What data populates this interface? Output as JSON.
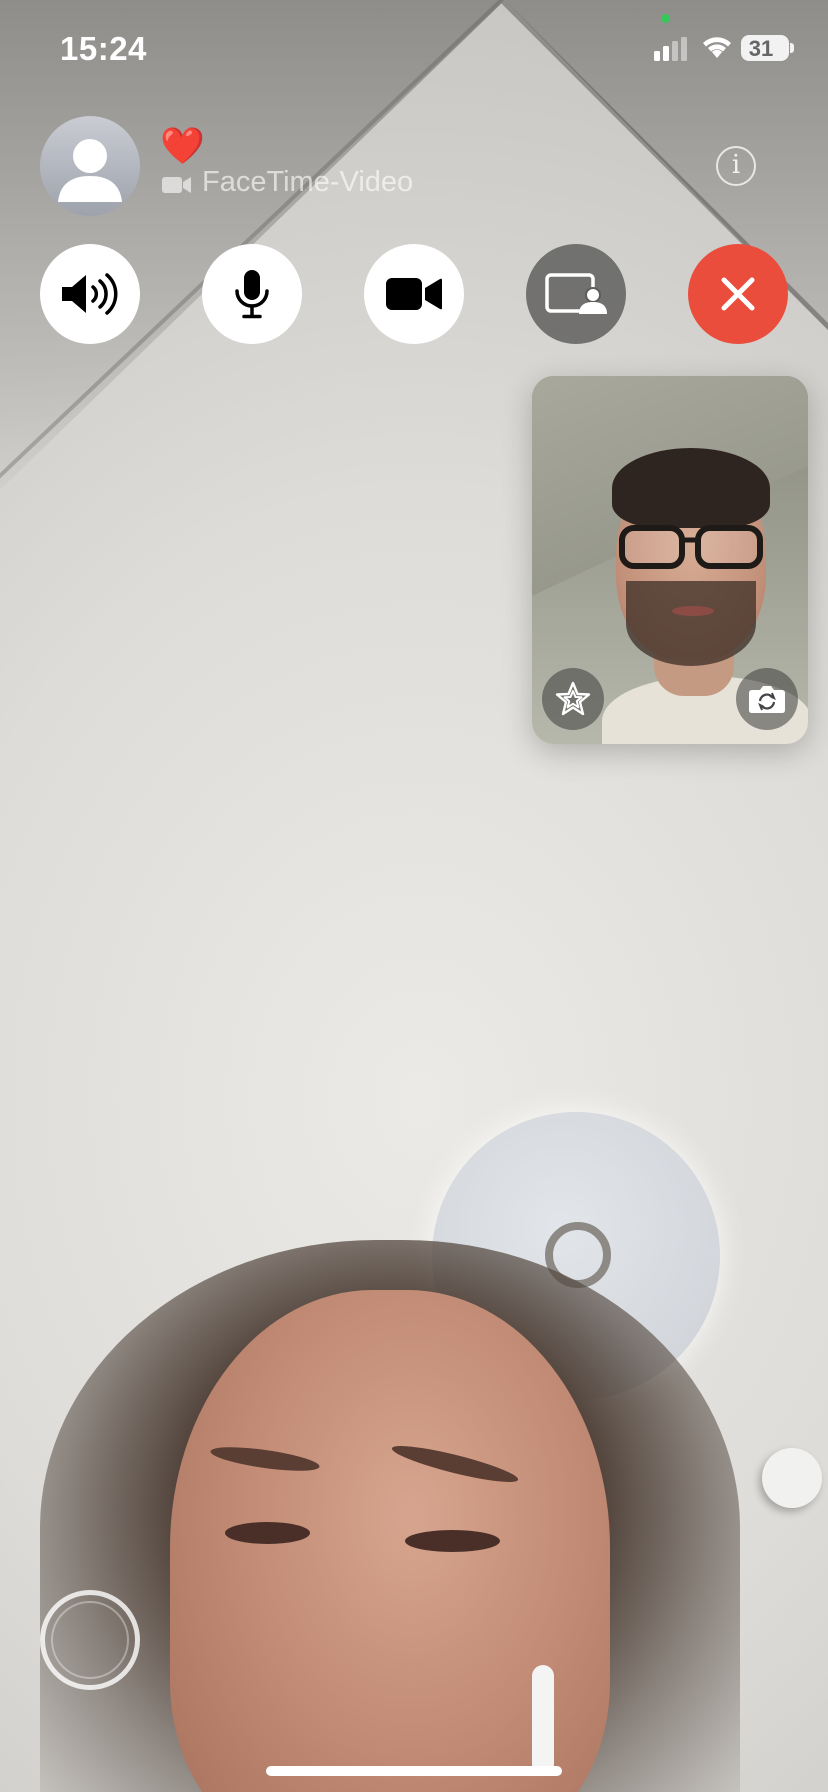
{
  "status_bar": {
    "time": "15:24",
    "battery": "31",
    "camera_in_use_dot_color": "#35c759"
  },
  "call": {
    "caller_name": "❤️",
    "call_type_icon": "video-camera-icon",
    "call_type": "FaceTime-Video",
    "info_icon_glyph": "i"
  },
  "controls": [
    {
      "name": "speaker",
      "icon": "speaker-wave-icon",
      "active": true
    },
    {
      "name": "mute",
      "icon": "microphone-icon",
      "active": false
    },
    {
      "name": "camera",
      "icon": "video-camera-icon",
      "active": true
    },
    {
      "name": "share-screen",
      "icon": "share-screen-icon",
      "active": false
    },
    {
      "name": "end-call",
      "icon": "close-icon",
      "color": "#eb4d3d"
    }
  ],
  "self_preview": {
    "effects_icon": "star-effects-icon",
    "flip_icon": "camera-flip-icon"
  },
  "shutter_icon": "live-photo-shutter-icon"
}
